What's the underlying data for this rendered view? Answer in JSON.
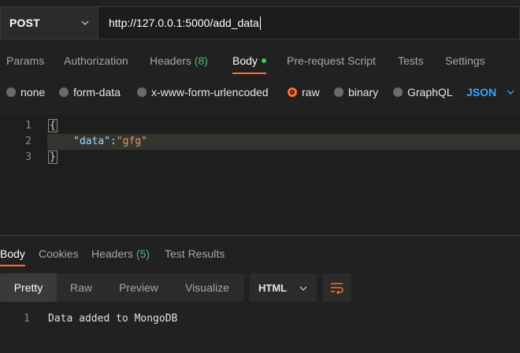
{
  "request": {
    "method": "POST",
    "url": "http://127.0.0.1:5000/add_data"
  },
  "tabs": [
    {
      "label": "Params"
    },
    {
      "label": "Authorization"
    },
    {
      "label": "Headers",
      "count": "(8)"
    },
    {
      "label": "Body",
      "active": true
    },
    {
      "label": "Pre-request Script"
    },
    {
      "label": "Tests"
    },
    {
      "label": "Settings"
    }
  ],
  "body_types": [
    {
      "label": "none"
    },
    {
      "label": "form-data"
    },
    {
      "label": "x-www-form-urlencoded"
    },
    {
      "label": "raw",
      "selected": true
    },
    {
      "label": "binary"
    },
    {
      "label": "GraphQL"
    }
  ],
  "raw_format": "JSON",
  "editor": {
    "line_numbers": [
      "1",
      "2",
      "3"
    ],
    "open_brace": "{",
    "key": "\"data\"",
    "colon": ":",
    "value": "\"gfg\"",
    "close_brace": "}"
  },
  "response_tabs": [
    {
      "label": "Body",
      "active": true
    },
    {
      "label": "Cookies"
    },
    {
      "label": "Headers",
      "count": "(5)"
    },
    {
      "label": "Test Results"
    }
  ],
  "response_views": [
    {
      "label": "Pretty",
      "active": true
    },
    {
      "label": "Raw"
    },
    {
      "label": "Preview"
    },
    {
      "label": "Visualize"
    }
  ],
  "response_format": "HTML",
  "response": {
    "line_number": "1",
    "text": "Data added to MongoDB"
  },
  "colors": {
    "accent": "#ff6c37",
    "link": "#3aa0ff",
    "count": "#5bb56a",
    "background": "#212121"
  }
}
